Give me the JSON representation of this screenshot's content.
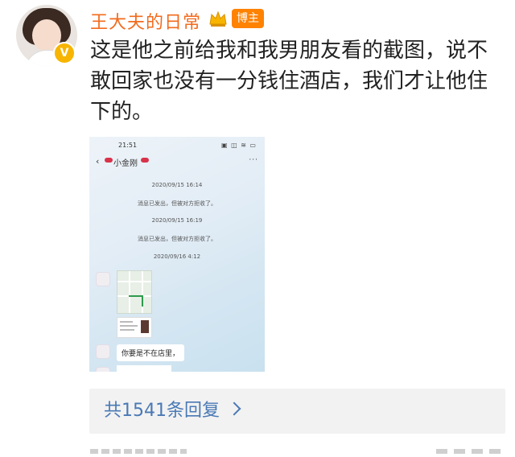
{
  "post": {
    "username": "王大夫的日常",
    "badge": "博主",
    "verified_mark": "V",
    "text": "这是他之前给我和我男朋友看的截图，说不敢回家也没有一分钱住酒店，我们才让他住下的。",
    "replies_label": "共1541条回复"
  },
  "screenshot": {
    "time": "21:51",
    "status_icons": "▣ ◫ ≋ ▭",
    "contact_name": "小金刚",
    "more_icon": "···",
    "messages": [
      {
        "timestamp": "2020/09/15 16:14",
        "note": "消息已发出，但被对方拒收了。"
      },
      {
        "timestamp": "2020/09/15 16:19",
        "note": "消息已发出，但被对方拒收了。"
      }
    ],
    "last_timestamp": "2020/09/16 4:12",
    "bubble_text": "你要是不在店里，"
  },
  "colors": {
    "username": "#f26b1d",
    "badge_bg": "#ff8200",
    "link": "#4a79b5",
    "verified": "#f7b500"
  },
  "icons": [
    "avatar",
    "verified-v-icon",
    "crown-icon",
    "back-arrow-icon",
    "lips-icon",
    "more-icon",
    "chevron-right-icon"
  ]
}
